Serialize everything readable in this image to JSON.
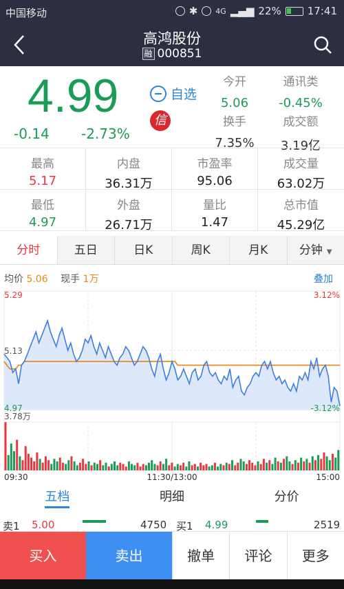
{
  "status": {
    "carrier": "中国移动",
    "network": "4G",
    "battery": "22%",
    "time": "17:41"
  },
  "header": {
    "title": "高鸿股份",
    "margin_tag": "融",
    "code": "000851"
  },
  "quote": {
    "price": "4.99",
    "change": "-0.14",
    "change_pct": "-2.73%",
    "watch_label": "自选",
    "credit_glyph": "信",
    "open_label": "今开",
    "open": "5.06",
    "sector_label": "通讯类",
    "sector": "-0.45%",
    "turnover_label": "换手",
    "turnover": "7.35%",
    "amount_label": "成交额",
    "amount": "3.19亿"
  },
  "stats": [
    {
      "label": "最高",
      "value": "5.17",
      "color": "#e8373e"
    },
    {
      "label": "内盘",
      "value": "36.31万",
      "color": "#222222"
    },
    {
      "label": "市盈率",
      "value": "95.06",
      "color": "#222222"
    },
    {
      "label": "成交量",
      "value": "63.02万",
      "color": "#222222"
    },
    {
      "label": "最低",
      "value": "4.97",
      "color": "#1a9c57"
    },
    {
      "label": "外盘",
      "value": "26.71万",
      "color": "#222222"
    },
    {
      "label": "量比",
      "value": "1.47",
      "color": "#222222"
    },
    {
      "label": "总市值",
      "value": "45.29亿",
      "color": "#222222"
    }
  ],
  "tabs": [
    "分时",
    "五日",
    "日K",
    "周K",
    "月K",
    "分钟"
  ],
  "legend": {
    "avg_label": "均价",
    "avg": "5.06",
    "now_label": "现手",
    "now": "1万",
    "overlay": "叠加"
  },
  "chart_data": {
    "type": "line",
    "ylim": [
      4.97,
      5.29
    ],
    "left_ticks": [
      "5.29",
      "5.13",
      "4.97"
    ],
    "right_ticks": [
      "3.12%",
      "-3.12%"
    ],
    "vol_max_label": "3.78万",
    "x_ticks": [
      "09:30",
      "11:30/13:00",
      "15:00"
    ],
    "series": [
      {
        "values": [
          5.12,
          5.11,
          5.1,
          5.07,
          5.08,
          5.04,
          5.09,
          5.1,
          5.12,
          5.14,
          5.16,
          5.18,
          5.15,
          5.17,
          5.19,
          5.21,
          5.18,
          5.16,
          5.14,
          5.17,
          5.19,
          5.16,
          5.13,
          5.15,
          5.12,
          5.1,
          5.11,
          5.13,
          5.16,
          5.15,
          5.17,
          5.14,
          5.12,
          5.15,
          5.13,
          5.11,
          5.14,
          5.12,
          5.1,
          5.09,
          5.11,
          5.12,
          5.14,
          5.13,
          5.11,
          5.09,
          5.1,
          5.12,
          5.14,
          5.13,
          5.11,
          5.08,
          5.06,
          5.1,
          5.12,
          5.08,
          5.05,
          5.07,
          5.1,
          5.08,
          5.05,
          5.06,
          5.08,
          5.06,
          5.04,
          5.07,
          5.08,
          5.05,
          5.06,
          5.09,
          5.1,
          5.07,
          5.06,
          5.07,
          5.05,
          5.04,
          5.06,
          5.05,
          5.08,
          5.03,
          5.05,
          5.06,
          5.02,
          5.01,
          5.03,
          5.04,
          5.06,
          5.07,
          5.06,
          5.09,
          5.1,
          5.08,
          5.1,
          5.07,
          5.05,
          5.06,
          5.04,
          5.05,
          5.03,
          5.02,
          5.04,
          5.02,
          5.06,
          5.05,
          5.07,
          5.05,
          5.1,
          5.08,
          5.11,
          5.06,
          5.08,
          5.09,
          5.06,
          4.99,
          5.03,
          5.02,
          4.98
        ]
      },
      {
        "values": [
          5.1,
          5.09,
          5.08,
          5.08,
          5.08,
          5.09,
          5.09,
          5.1,
          5.1,
          5.1,
          5.1,
          5.1,
          5.1,
          5.1,
          5.1,
          5.1,
          5.1,
          5.1,
          5.1,
          5.1,
          5.1,
          5.1,
          5.1,
          5.1,
          5.1,
          5.1,
          5.1,
          5.1,
          5.1,
          5.1,
          5.1,
          5.1,
          5.1,
          5.1,
          5.1,
          5.1,
          5.1,
          5.1,
          5.1,
          5.1,
          5.1,
          5.1,
          5.1,
          5.1,
          5.1,
          5.1,
          5.1,
          5.1,
          5.1,
          5.1,
          5.1,
          5.1,
          5.1,
          5.1,
          5.1,
          5.1,
          5.1,
          5.1,
          5.1,
          5.1,
          5.09,
          5.09,
          5.09,
          5.09,
          5.09,
          5.09,
          5.09,
          5.09,
          5.09,
          5.09,
          5.09,
          5.09,
          5.09,
          5.09,
          5.09,
          5.09,
          5.09,
          5.09,
          5.09,
          5.09,
          5.09,
          5.09,
          5.09,
          5.09,
          5.09,
          5.09,
          5.09,
          5.09,
          5.09,
          5.09,
          5.09,
          5.09,
          5.09,
          5.09,
          5.09,
          5.09,
          5.09,
          5.09,
          5.09,
          5.09,
          5.09,
          5.09,
          5.09,
          5.09,
          5.09,
          5.09,
          5.09,
          5.09,
          5.09,
          5.09,
          5.09,
          5.09,
          5.09,
          5.09,
          5.09,
          5.09,
          5.09
        ]
      }
    ],
    "volume": [
      3.78,
      1.2,
      2.1,
      1.5,
      2.4,
      1.1,
      0.8,
      1.9,
      1.3,
      1.0,
      0.7,
      1.4,
      0.9,
      0.6,
      1.1,
      0.8,
      0.5,
      0.9,
      0.7,
      1.0,
      0.6,
      0.5,
      0.8,
      1.1,
      0.7,
      0.4,
      0.6,
      0.9,
      0.5,
      0.7,
      0.4,
      0.6,
      0.5,
      0.8,
      0.4,
      0.6,
      0.3,
      0.5,
      0.7,
      0.4,
      0.6,
      0.5,
      0.3,
      0.7,
      0.5,
      0.4,
      0.6,
      0.3,
      0.5,
      0.4,
      0.6,
      0.8,
      0.5,
      0.4,
      0.7,
      0.5,
      0.9,
      0.4,
      0.6,
      0.3,
      0.5,
      0.4,
      0.6,
      0.3,
      0.7,
      0.4,
      0.5,
      0.3,
      0.6,
      0.4,
      0.5,
      0.3,
      0.4,
      0.6,
      0.3,
      0.5,
      0.4,
      0.6,
      0.5,
      0.8,
      0.4,
      0.6,
      0.9,
      0.7,
      0.5,
      0.8,
      0.6,
      0.4,
      0.7,
      0.5,
      0.9,
      0.6,
      0.8,
      0.5,
      1.0,
      0.7,
      0.6,
      0.9,
      1.1,
      0.7,
      0.5,
      0.8,
      0.6,
      1.0,
      0.7,
      0.9,
      0.6,
      1.1,
      0.8,
      1.2,
      0.9,
      1.4,
      1.1,
      0.8,
      1.3,
      1.0,
      1.6
    ],
    "volume_colors": [
      "#e8373e",
      "#1a9c57"
    ]
  },
  "bottom_tabs": [
    "五档",
    "明细",
    "分价"
  ],
  "order_peek": {
    "sell_label": "卖1",
    "sell_price": "5.00",
    "sell_vol": "4750",
    "buy_label": "买1",
    "buy_price": "4.99",
    "buy_vol": "2519"
  },
  "actions": {
    "buy": "买入",
    "sell": "卖出",
    "cancel": "撤单",
    "comment": "评论",
    "more": "更多"
  }
}
